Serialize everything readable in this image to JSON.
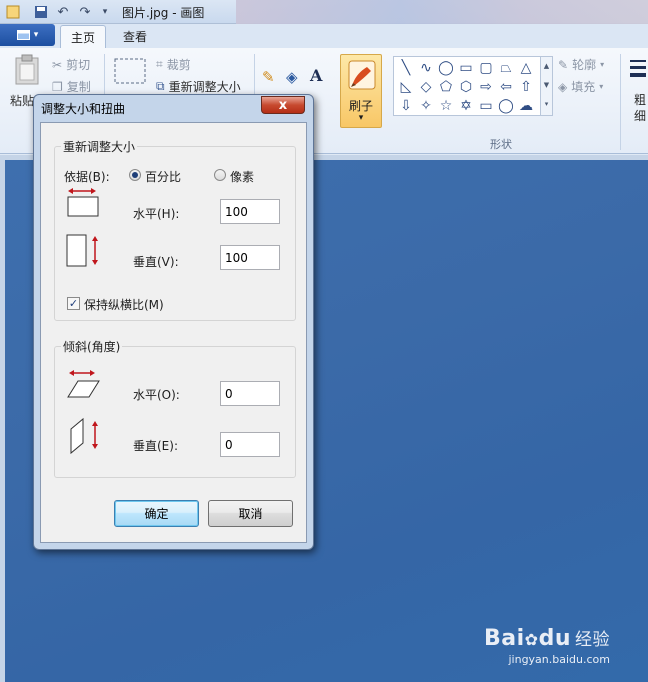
{
  "window": {
    "title": "图片.jpg - 画图"
  },
  "ribbon": {
    "tabs": [
      "主页",
      "查看"
    ],
    "clipboard": {
      "paste": "粘贴",
      "cut": "剪切",
      "copy": "复制"
    },
    "image": {
      "crop": "裁剪",
      "resize": "重新调整大小"
    },
    "brushes_label": "刷子",
    "outline": "轮廓",
    "fill": "填充",
    "shapes_group": "形状",
    "size_label": "粗细"
  },
  "dialog": {
    "title": "调整大小和扭曲",
    "close": "x",
    "resize_group": "重新调整大小",
    "by_label": "依据(B):",
    "percent": "百分比",
    "pixels": "像素",
    "horizontal_label": "水平(H):",
    "horizontal_value": "100",
    "vertical_label": "垂直(V):",
    "vertical_value": "100",
    "maintain_aspect": "保持纵横比(M)",
    "maintain_aspect_checked": true,
    "skew_group": "倾斜(角度)",
    "skew_horizontal_label": "水平(O):",
    "skew_horizontal_value": "0",
    "skew_vertical_label": "垂直(E):",
    "skew_vertical_value": "0",
    "ok": "确定",
    "cancel": "取消"
  },
  "watermark": {
    "logo": "Bai",
    "logo_tail": "du",
    "cn": "经验",
    "url": "jingyan.baidu.com"
  },
  "colors": {
    "accent": "#1d4fa0",
    "image_bg": "#3b6aa8",
    "dialog_frame": "#c4d5ea"
  }
}
